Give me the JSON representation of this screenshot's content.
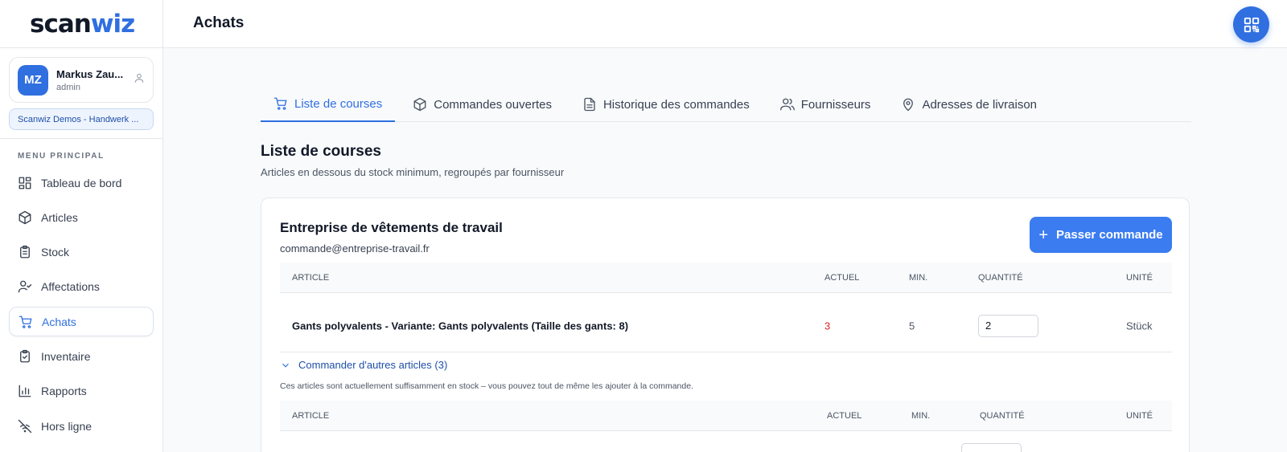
{
  "app": {
    "logo_part1": "scan",
    "logo_part2": "wiz",
    "brand_color": "#2f6fe0"
  },
  "user": {
    "initials": "MZ",
    "name": "Markus Zau...",
    "role": "admin",
    "organization": "Scanwiz Demos - Handwerk ..."
  },
  "sidebar": {
    "heading": "MENU PRINCIPAL",
    "items": [
      {
        "label": "Tableau de bord",
        "icon": "dashboard-icon"
      },
      {
        "label": "Articles",
        "icon": "box-icon"
      },
      {
        "label": "Stock",
        "icon": "clipboard-list-icon"
      },
      {
        "label": "Affectations",
        "icon": "user-check-icon"
      },
      {
        "label": "Achats",
        "icon": "cart-icon",
        "active": true
      },
      {
        "label": "Inventaire",
        "icon": "clipboard-check-icon"
      },
      {
        "label": "Rapports",
        "icon": "bar-chart-icon"
      },
      {
        "label": "Hors ligne",
        "icon": "wifi-off-icon"
      }
    ]
  },
  "header": {
    "title": "Achats",
    "qr_icon": "qr-code-icon"
  },
  "tabs": [
    {
      "label": "Liste de courses",
      "icon": "cart-icon",
      "active": true
    },
    {
      "label": "Commandes ouvertes",
      "icon": "box-icon"
    },
    {
      "label": "Historique des commandes",
      "icon": "file-text-icon"
    },
    {
      "label": "Fournisseurs",
      "icon": "users-icon"
    },
    {
      "label": "Adresses de livraison",
      "icon": "map-pin-icon"
    }
  ],
  "section": {
    "title": "Liste de courses",
    "subtitle": "Articles en dessous du stock minimum, regroupés par fournisseur"
  },
  "supplier": {
    "name": "Entreprise de vêtements de travail",
    "email": "commande@entreprise-travail.fr",
    "order_button": "Passer commande"
  },
  "table": {
    "headers": {
      "article": "ARTICLE",
      "actuel": "ACTUEL",
      "min": "MIN.",
      "quantite": "QUANTITÉ",
      "unite": "UNITÉ"
    },
    "rows": [
      {
        "article": "Gants polyvalents - Variante: Gants polyvalents (Taille des gants: 8)",
        "actuel": "3",
        "min": "5",
        "quantite": "2",
        "unite": "Stück"
      }
    ]
  },
  "more_articles": {
    "toggle_label": "Commander d'autres articles (3)",
    "note": "Ces articles sont actuellement suffisamment en stock – vous pouvez tout de même les ajouter à la commande."
  }
}
